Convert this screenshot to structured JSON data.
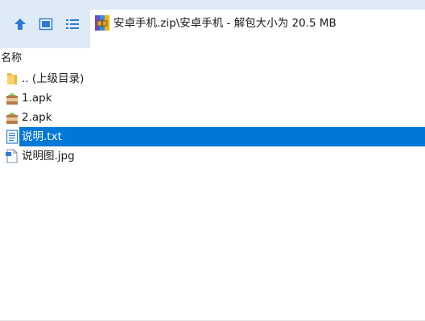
{
  "toolbar": {
    "buttons": [
      {
        "name": "up-button",
        "icon": "up-arrow-icon"
      },
      {
        "name": "view-button",
        "icon": "view-panel-icon"
      },
      {
        "name": "list-button",
        "icon": "list-icon"
      }
    ],
    "path_icon": "archive-icon",
    "path_text": "安卓手机.zip\\安卓手机 - 解包大小为 20.5 MB"
  },
  "columns": {
    "name": "名称"
  },
  "files": [
    {
      "name": ".. (上级目录)",
      "icon": "folder-icon",
      "selected": false
    },
    {
      "name": "1.apk",
      "icon": "apk-icon",
      "selected": false
    },
    {
      "name": "2.apk",
      "icon": "apk-icon",
      "selected": false
    },
    {
      "name": "说明.txt",
      "icon": "text-file-icon",
      "selected": true
    },
    {
      "name": "说明图.jpg",
      "icon": "image-file-icon",
      "selected": false
    }
  ],
  "colors": {
    "toolbar_bg": "#dfeaf7",
    "accent_icon": "#2b7bd6",
    "selection": "#0078d7"
  }
}
